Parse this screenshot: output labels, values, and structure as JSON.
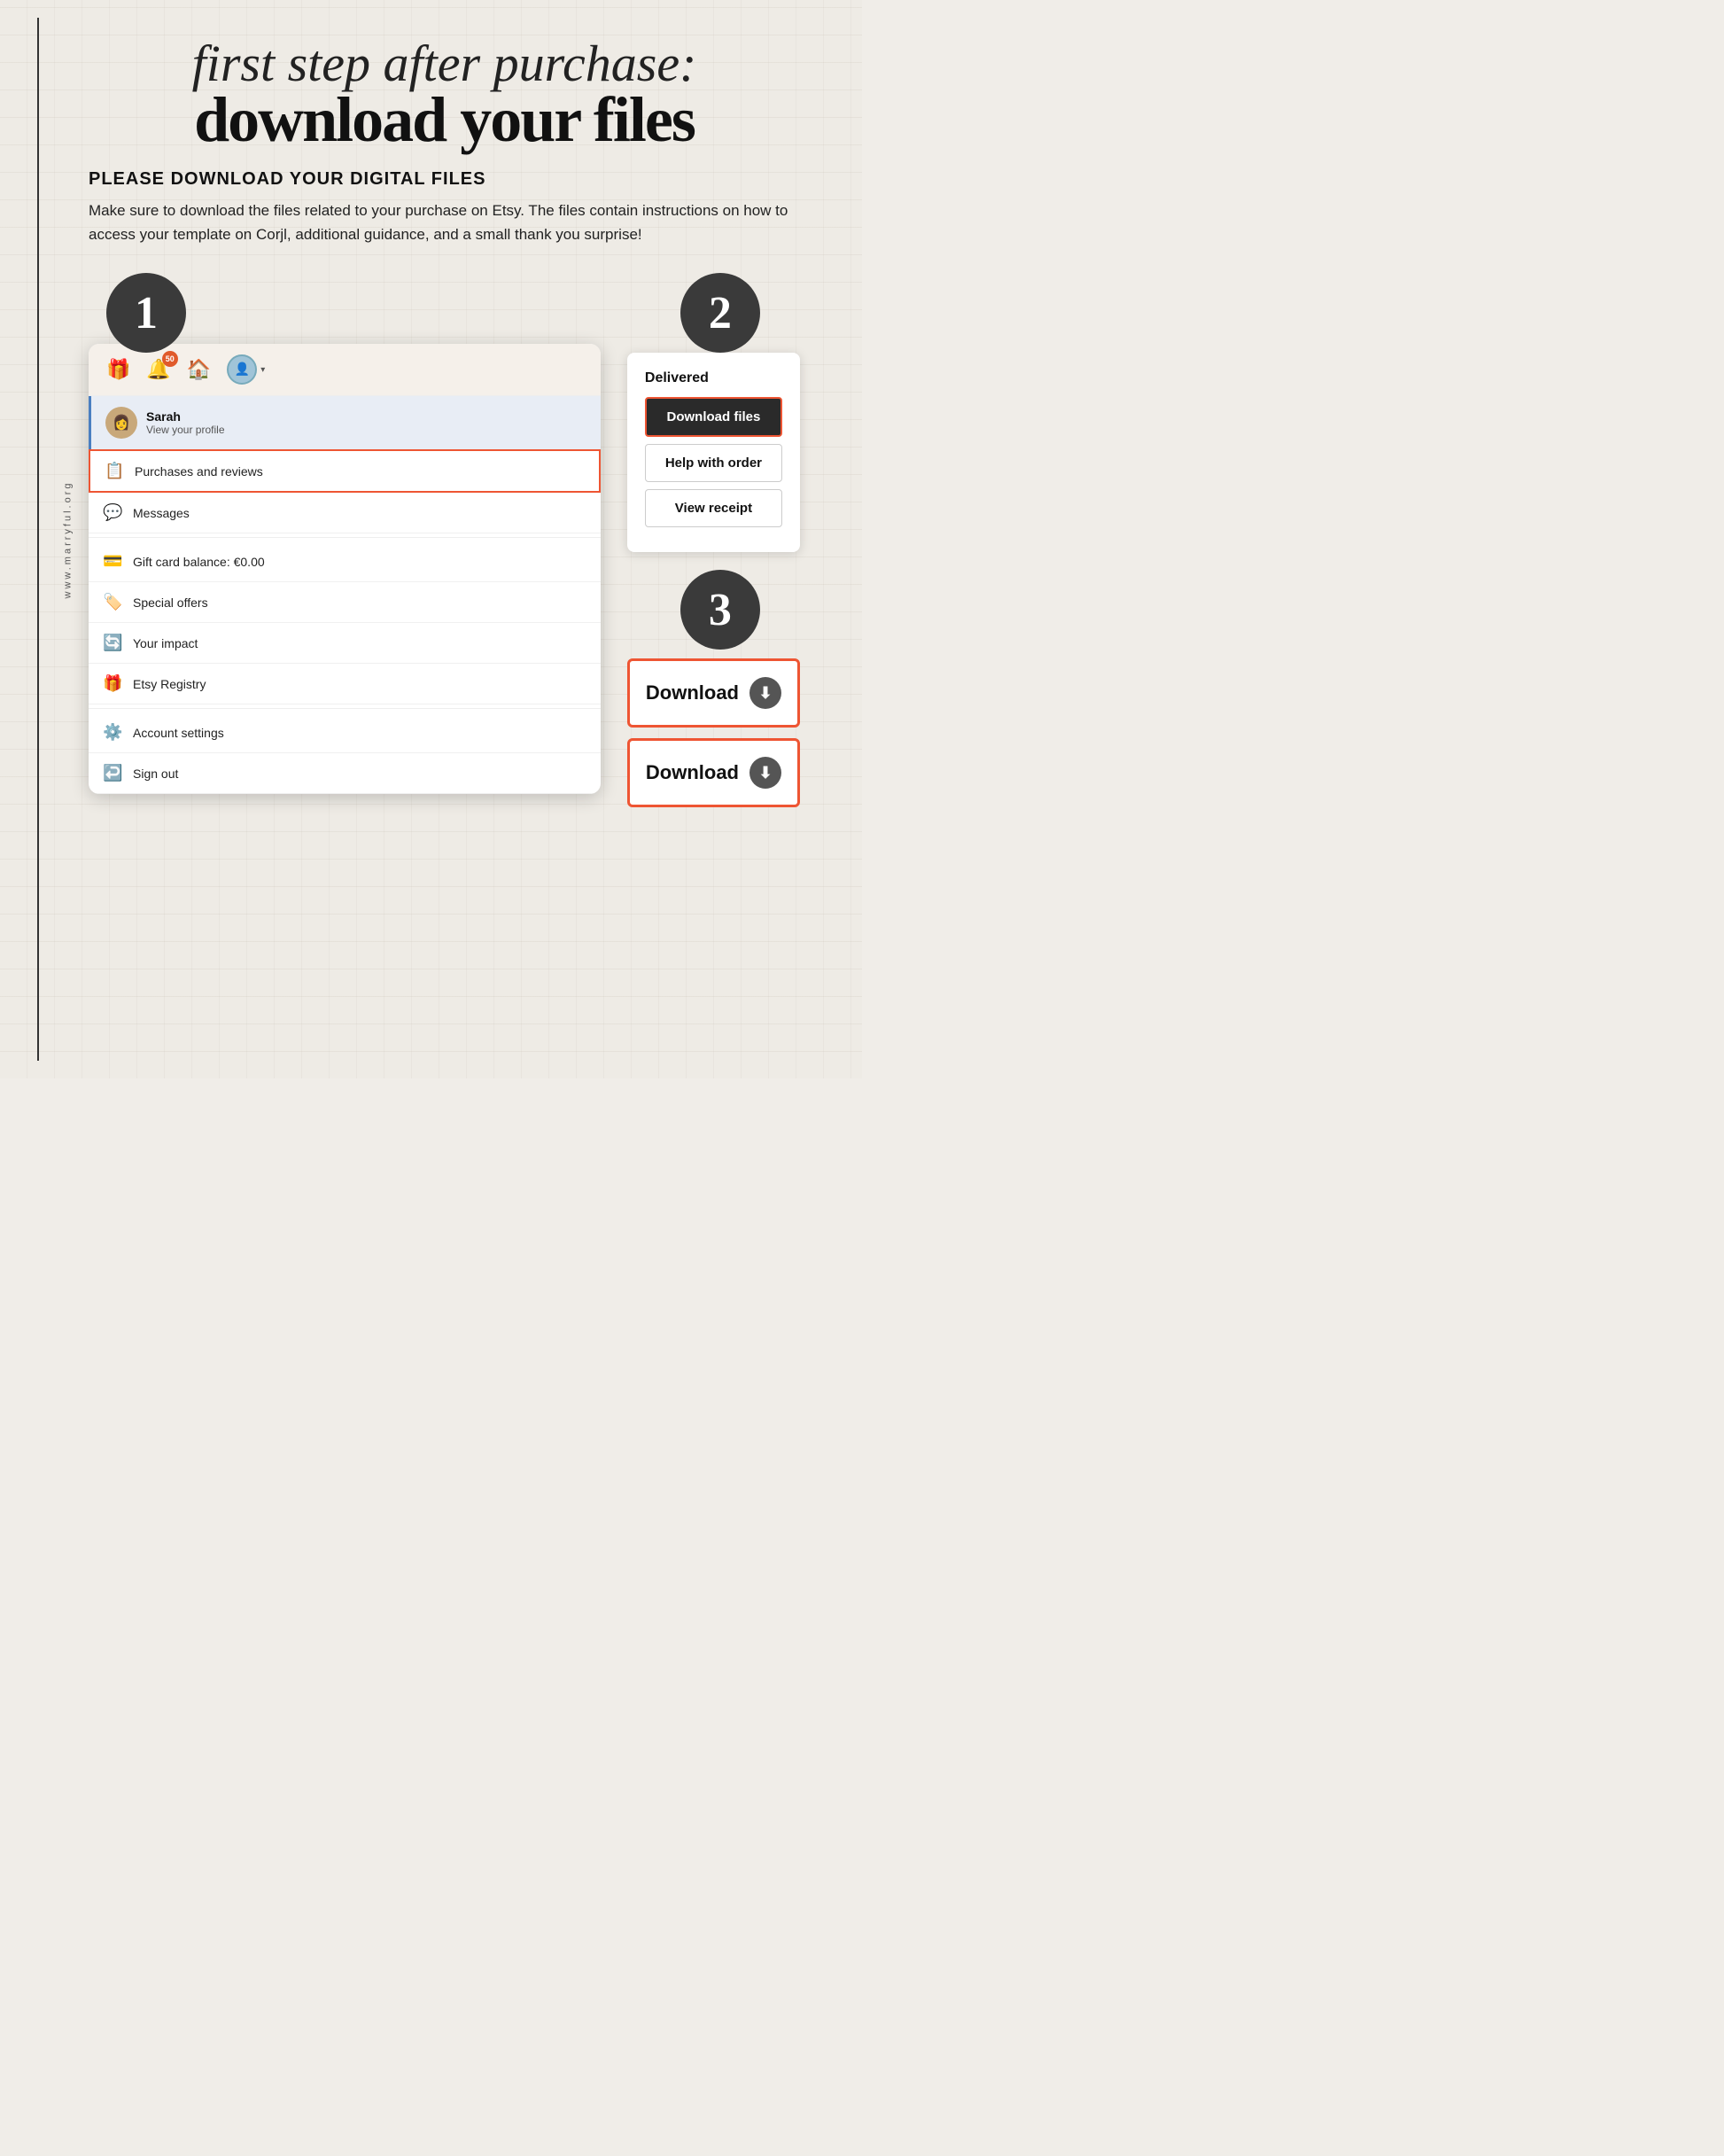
{
  "watermark": "www.marryful.org",
  "header": {
    "script_line": "first step after purchase:",
    "main_title": "download your files"
  },
  "content": {
    "subtitle": "PLEASE DOWNLOAD YOUR DIGITAL FILES",
    "description": "Make sure to download the files related to your purchase on Etsy. The files contain instructions on how to access your template on Corjl, additional guidance, and a small thank you surprise!"
  },
  "step1": {
    "number": "1",
    "topbar": {
      "notification_count": "50"
    },
    "profile": {
      "name": "Sarah",
      "link_text": "View your profile"
    },
    "menu_items": [
      {
        "icon": "📋",
        "label": "Purchases and reviews",
        "highlighted": true
      },
      {
        "icon": "💬",
        "label": "Messages",
        "highlighted": false
      },
      {
        "icon": "💳",
        "label": "Gift card balance: €0.00",
        "highlighted": false
      },
      {
        "icon": "🏷️",
        "label": "Special offers",
        "highlighted": false
      },
      {
        "icon": "🔄",
        "label": "Your impact",
        "highlighted": false
      },
      {
        "icon": "🎁",
        "label": "Etsy Registry",
        "highlighted": false
      },
      {
        "icon": "⚙️",
        "label": "Account settings",
        "highlighted": false
      },
      {
        "icon": "↩️",
        "label": "Sign out",
        "highlighted": false
      }
    ]
  },
  "step2": {
    "number": "2",
    "delivered_label": "Delivered",
    "buttons": [
      {
        "label": "Download files",
        "style": "dark",
        "highlighted": true
      },
      {
        "label": "Help with order",
        "style": "outline",
        "highlighted": false
      },
      {
        "label": "View receipt",
        "style": "outline",
        "highlighted": false
      }
    ]
  },
  "step3": {
    "number": "3",
    "download_buttons": [
      {
        "label": "Download"
      },
      {
        "label": "Download"
      }
    ]
  }
}
